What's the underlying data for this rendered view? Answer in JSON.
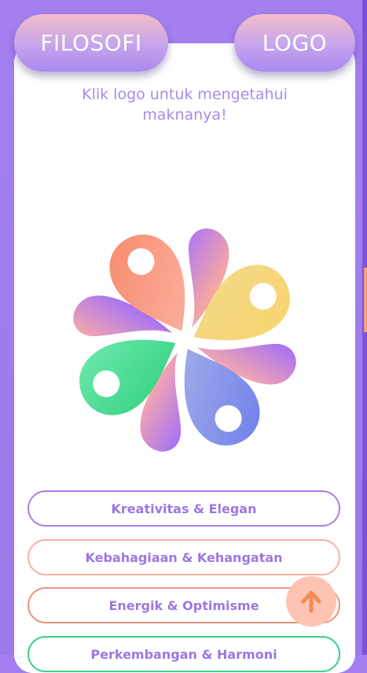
{
  "header": {
    "left_pill_label": "FILOSOFI",
    "right_pill_label": "LOGO"
  },
  "instruction": {
    "line1": "Klik logo untuk mengetahui",
    "line2": "maknanya!"
  },
  "logo": {
    "petal_colors": [
      "#f7906e",
      "#f5d36a",
      "#7b86ea",
      "#36d28a",
      "#b57af0",
      "#f5a0a4"
    ]
  },
  "meanings": [
    {
      "label": "Kreativitas & Elegan",
      "border_color": "#b07ee6"
    },
    {
      "label": "Kebahagiaan & Kehangatan",
      "border_color": "#f4b3a6"
    },
    {
      "label": "Energik & Optimisme",
      "border_color": "#e9957b"
    },
    {
      "label": "Perkembangan & Harmoni",
      "border_color": "#3ccf87"
    }
  ],
  "scroll_top": {
    "icon": "arrow-up-icon",
    "color": "#f48a54"
  }
}
